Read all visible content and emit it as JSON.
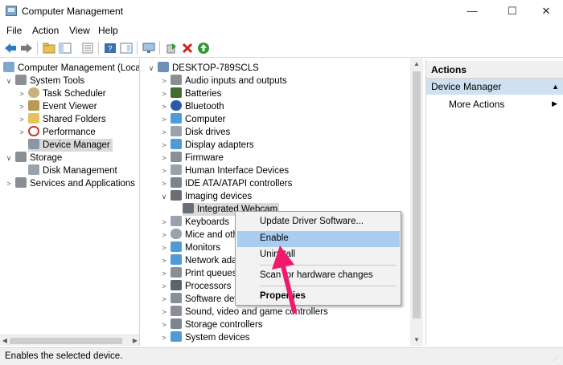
{
  "window": {
    "title": "Computer Management",
    "minimize": "—",
    "maximize": "☐",
    "close": "✕"
  },
  "menu": [
    "File",
    "Action",
    "View",
    "Help"
  ],
  "toolbar_icons": [
    "back-arrow-icon",
    "forward-arrow-icon",
    "up-folder-icon",
    "show-hide-tree-icon",
    "properties-icon",
    "help-icon",
    "console-tree-icon",
    "monitor-icon",
    "update-driver-icon",
    "uninstall-x-icon",
    "enable-device-icon"
  ],
  "left_tree": {
    "root": "Computer Management (Local",
    "system_tools": "System Tools",
    "task_scheduler": "Task Scheduler",
    "event_viewer": "Event Viewer",
    "shared_folders": "Shared Folders",
    "performance": "Performance",
    "device_manager": "Device Manager",
    "storage": "Storage",
    "disk_management": "Disk Management",
    "services": "Services and Applications"
  },
  "device_tree": {
    "root": "DESKTOP-789SCLS",
    "items": [
      "Audio inputs and outputs",
      "Batteries",
      "Bluetooth",
      "Computer",
      "Disk drives",
      "Display adapters",
      "Firmware",
      "Human Interface Devices",
      "IDE ATA/ATAPI controllers",
      "Imaging devices",
      "Integrated Webcam",
      "Keyboards",
      "Mice and oth",
      "Monitors",
      "Network ada",
      "Print queues",
      "Processors",
      "Software dev",
      "Sound, video and game controllers",
      "Storage controllers",
      "System devices"
    ]
  },
  "actions": {
    "header": "Actions",
    "section": "Device Manager",
    "more": "More Actions"
  },
  "context_menu": {
    "update": "Update Driver Software...",
    "enable": "Enable",
    "uninstall": "Uninstall",
    "scan": "Scan for hardware changes",
    "properties": "Properties"
  },
  "status": {
    "text": "Enables the selected device."
  },
  "colors": {
    "highlight": "#a9cdf0",
    "actions_section": "#cfe0f1",
    "annotation_arrow": "#f0196e"
  }
}
